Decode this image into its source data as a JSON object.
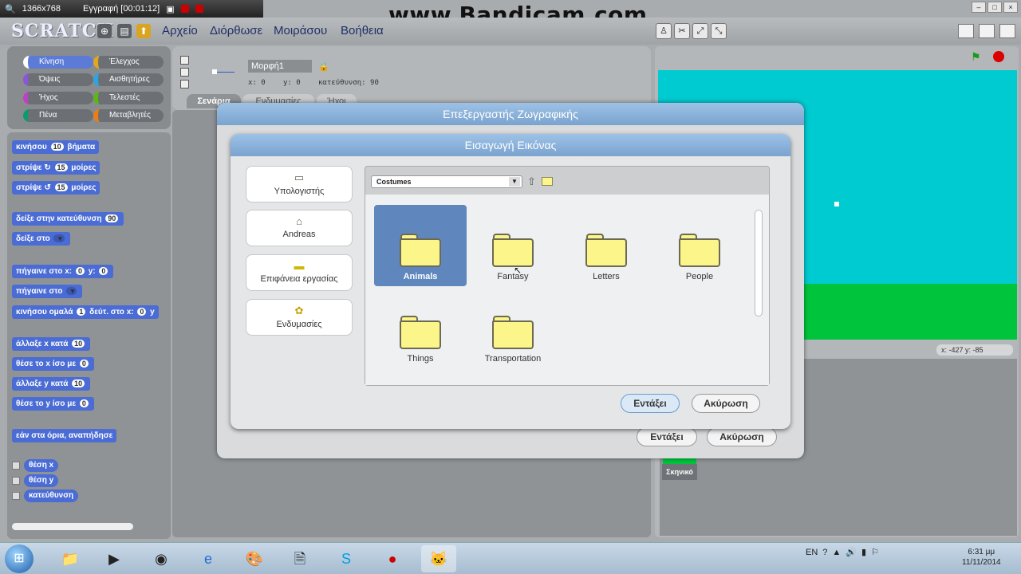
{
  "recorder": {
    "resolution": "1366x768",
    "status": "Εγγραφή [00:01:12]",
    "watermark": "www.Bandicam.com"
  },
  "app": {
    "logo": "SCRATCH",
    "menu": [
      "Αρχείο",
      "Διόρθωσε",
      "Μοιράσου",
      "Βοήθεια"
    ]
  },
  "categories": [
    {
      "label": "Κίνηση",
      "color": "#4a6cd4"
    },
    {
      "label": "Έλεγχος",
      "color": "#e1a91a"
    },
    {
      "label": "Όψεις",
      "color": "#8a55d7"
    },
    {
      "label": "Αισθητήρες",
      "color": "#2ca5e2"
    },
    {
      "label": "Ήχος",
      "color": "#bb42c3"
    },
    {
      "label": "Τελεστές",
      "color": "#5cb712"
    },
    {
      "label": "Πένα",
      "color": "#0e9a6c"
    },
    {
      "label": "Μεταβλητές",
      "color": "#ee7d16"
    }
  ],
  "blocks": {
    "move": {
      "label": "κινήσου",
      "value": "10",
      "suffix": "βήματα"
    },
    "turn_right": {
      "label": "στρίψε",
      "value": "15",
      "suffix": "μοίρες"
    },
    "turn_left": {
      "label": "στρίψε",
      "value": "15",
      "suffix": "μοίρες"
    },
    "point_dir": {
      "label": "δείξε στην κατεύθυνση",
      "value": "90"
    },
    "point_to": {
      "label": "δείξε στο"
    },
    "goto_xy": {
      "label": "πήγαινε στο x:",
      "x": "0",
      "y_label": "y:",
      "y": "0"
    },
    "goto": {
      "label": "πήγαινε στο"
    },
    "glide": {
      "label": "κινήσου ομαλά",
      "value": "1",
      "mid": "δεύτ. στο x:",
      "x": "0",
      "y": "y"
    },
    "change_x": {
      "label": "άλλαξε x κατά",
      "value": "10"
    },
    "set_x": {
      "label": "θέσε το x ίσο με",
      "value": "0"
    },
    "change_y": {
      "label": "άλλαξε y κατά",
      "value": "10"
    },
    "set_y": {
      "label": "θέσε το y ίσο με",
      "value": "0"
    },
    "bounce": {
      "label": "εάν στα όρια, αναπήδησε"
    },
    "rep_x": "θέση x",
    "rep_y": "θέση y",
    "rep_dir": "κατεύθυνση"
  },
  "sprite": {
    "name": "Μορφή1",
    "x": "x: 0",
    "y": "y: 0",
    "direction": "κατεύθυνση: 90",
    "tabs": [
      "Σενάρια",
      "Ενδυμασίες",
      "Ήχοι"
    ]
  },
  "stage": {
    "mouse_coords": "x: -427   y: -85",
    "stage_label": "Σκηνικό"
  },
  "paint_editor": {
    "title": "Επεξεργαστής Ζωγραφικής",
    "ok": "Εντάξει",
    "cancel": "Ακύρωση"
  },
  "import_dialog": {
    "title": "Εισαγωγή Εικόνας",
    "locations": [
      {
        "label": "Υπολογιστής",
        "icon": "computer-icon"
      },
      {
        "label": "Andreas",
        "icon": "home-icon"
      },
      {
        "label": "Επιφάνεια εργασίας",
        "icon": "desktop-folder-icon"
      },
      {
        "label": "Ενδυμασίες",
        "icon": "costumes-icon"
      }
    ],
    "current_dir": "Costumes",
    "folders": [
      "Animals",
      "Fantasy",
      "Letters",
      "People",
      "Things",
      "Transportation"
    ],
    "selected_folder": "Animals",
    "ok": "Εντάξει",
    "cancel": "Ακύρωση"
  },
  "taskbar": {
    "lang": "EN",
    "time": "6:31 μμ",
    "date": "11/11/2014"
  }
}
